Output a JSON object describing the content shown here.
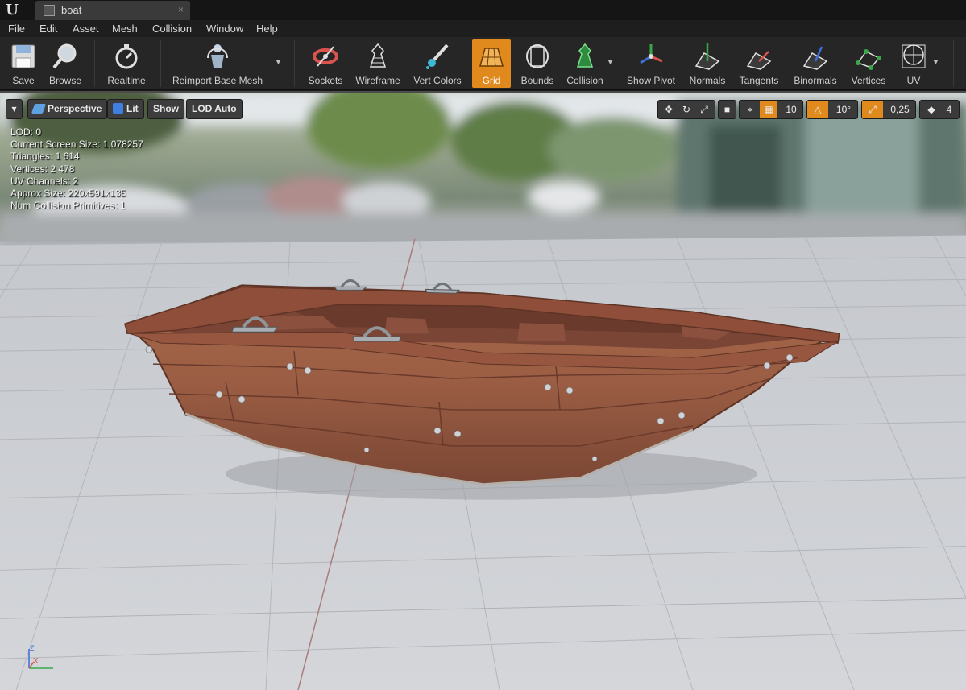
{
  "window": {
    "tab_title": "boat",
    "tab_close": "×",
    "logo": "U"
  },
  "menu": [
    "File",
    "Edit",
    "Asset",
    "Mesh",
    "Collision",
    "Window",
    "Help"
  ],
  "toolbar": {
    "save": "Save",
    "browse": "Browse",
    "realtime": "Realtime",
    "reimport": "Reimport Base Mesh",
    "sockets": "Sockets",
    "wireframe": "Wireframe",
    "vert_colors": "Vert Colors",
    "grid": "Grid",
    "bounds": "Bounds",
    "collision": "Collision",
    "show_pivot": "Show Pivot",
    "normals": "Normals",
    "tangents": "Tangents",
    "binormals": "Binormals",
    "vertices": "Vertices",
    "uv": "UV",
    "active_button": "Grid",
    "accent_color": "#e08a1e"
  },
  "viewport": {
    "view_mode": "Perspective",
    "lighting": "Lit",
    "show": "Show",
    "lod": "LOD Auto",
    "grid_snap": "10",
    "rotation_snap": "10°",
    "scale_snap": "0,25",
    "camera_speed": "4",
    "axis_z": "Z",
    "axis_x": "X"
  },
  "stats": {
    "lod": "LOD:  0",
    "screen_size": "Current Screen Size:  1,078257",
    "triangles": "Triangles:  1 614",
    "vertices": "Vertices:  2 478",
    "uv_channels": "UV Channels:  2",
    "approx_size": "Approx Size:  220x591x135",
    "collision_primitives": "Num Collision Primitives:  1"
  }
}
